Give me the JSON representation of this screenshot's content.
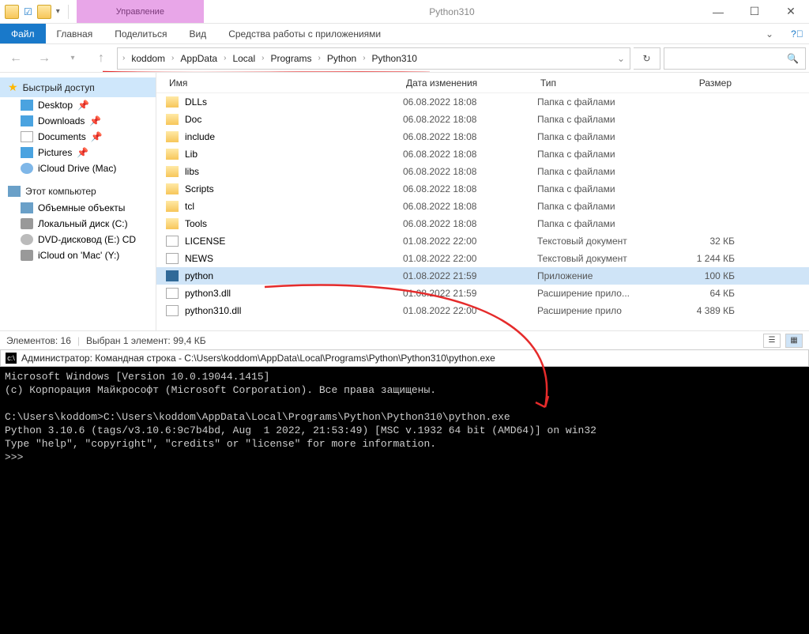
{
  "titlebar": {
    "context_label": "Управление",
    "title": "Python310"
  },
  "ribbon": {
    "file": "Файл",
    "tabs": [
      "Главная",
      "Поделиться",
      "Вид"
    ],
    "context_tab": "Средства работы с приложениями"
  },
  "breadcrumbs": [
    "koddom",
    "AppData",
    "Local",
    "Programs",
    "Python",
    "Python310"
  ],
  "nav": {
    "quick_access": "Быстрый доступ",
    "quick_items": [
      "Desktop",
      "Downloads",
      "Documents",
      "Pictures",
      "iCloud Drive (Mac)"
    ],
    "this_pc": "Этот компьютер",
    "pc_items": [
      "Объемные объекты",
      "Локальный диск (C:)",
      "DVD-дисковод (E:) CD",
      "iCloud on 'Mac' (Y:)"
    ]
  },
  "columns": {
    "name": "Имя",
    "date": "Дата изменения",
    "type": "Тип",
    "size": "Размер"
  },
  "folder_type": "Папка с файлами",
  "text_doc_type": "Текстовый документ",
  "app_type": "Приложение",
  "app_ext_type": "Расширение прило...",
  "app_ext_type2": "Расширение прило",
  "files": [
    {
      "icon": "folder",
      "name": "DLLs",
      "date": "06.08.2022 18:08",
      "type": "Папка с файлами",
      "size": ""
    },
    {
      "icon": "folder",
      "name": "Doc",
      "date": "06.08.2022 18:08",
      "type": "Папка с файлами",
      "size": ""
    },
    {
      "icon": "folder",
      "name": "include",
      "date": "06.08.2022 18:08",
      "type": "Папка с файлами",
      "size": ""
    },
    {
      "icon": "folder",
      "name": "Lib",
      "date": "06.08.2022 18:08",
      "type": "Папка с файлами",
      "size": ""
    },
    {
      "icon": "folder",
      "name": "libs",
      "date": "06.08.2022 18:08",
      "type": "Папка с файлами",
      "size": ""
    },
    {
      "icon": "folder",
      "name": "Scripts",
      "date": "06.08.2022 18:08",
      "type": "Папка с файлами",
      "size": ""
    },
    {
      "icon": "folder",
      "name": "tcl",
      "date": "06.08.2022 18:08",
      "type": "Папка с файлами",
      "size": ""
    },
    {
      "icon": "folder",
      "name": "Tools",
      "date": "06.08.2022 18:08",
      "type": "Папка с файлами",
      "size": ""
    },
    {
      "icon": "file",
      "name": "LICENSE",
      "date": "01.08.2022 22:00",
      "type": "Текстовый документ",
      "size": "32 КБ"
    },
    {
      "icon": "file",
      "name": "NEWS",
      "date": "01.08.2022 22:00",
      "type": "Текстовый документ",
      "size": "1 244 КБ"
    },
    {
      "icon": "app",
      "name": "python",
      "date": "01.08.2022 21:59",
      "type": "Приложение",
      "size": "100 КБ",
      "selected": true
    },
    {
      "icon": "file",
      "name": "python3.dll",
      "date": "01.08.2022 21:59",
      "type": "Расширение прило...",
      "size": "64 КБ"
    },
    {
      "icon": "file",
      "name": "python310.dll",
      "date": "01.08.2022 22:00",
      "type": "Расширение прило",
      "size": "4 389 КБ"
    }
  ],
  "status": {
    "count": "Элементов: 16",
    "selection": "Выбран 1 элемент: 99,4 КБ"
  },
  "console": {
    "title": "Администратор: Командная строка - C:\\Users\\koddom\\AppData\\Local\\Programs\\Python\\Python310\\python.exe",
    "lines": "Microsoft Windows [Version 10.0.19044.1415]\n(c) Корпорация Майкрософт (Microsoft Corporation). Все права защищены.\n\nC:\\Users\\koddom>C:\\Users\\koddom\\AppData\\Local\\Programs\\Python\\Python310\\python.exe\nPython 3.10.6 (tags/v3.10.6:9c7b4bd, Aug  1 2022, 21:53:49) [MSC v.1932 64 bit (AMD64)] on win32\nType \"help\", \"copyright\", \"credits\" or \"license\" for more information.\n>>>"
  }
}
